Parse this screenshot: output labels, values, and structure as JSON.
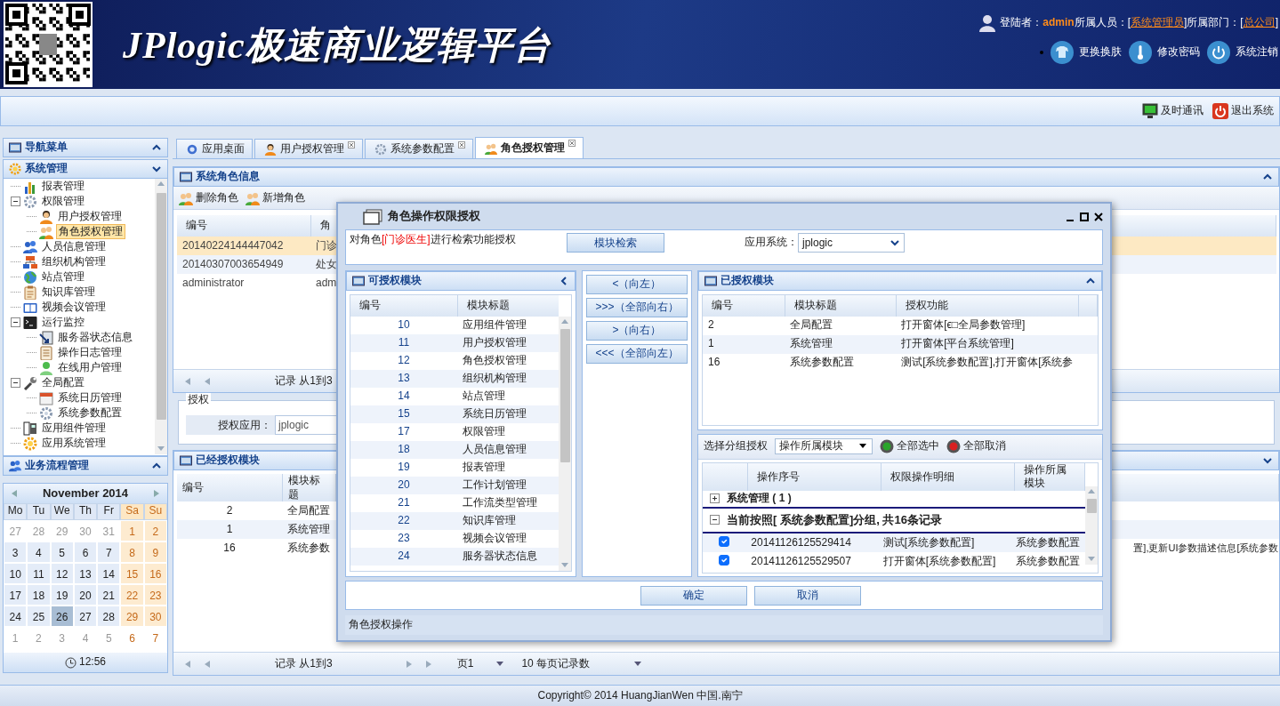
{
  "header": {
    "title": "JPlogic极速商业逻辑平台",
    "user_info": [
      {
        "text": "登陆者：",
        "kind": "label"
      },
      {
        "text": "admin",
        "kind": "value"
      },
      {
        "text": "所属人员：[",
        "kind": "label"
      },
      {
        "text": "系统管理员",
        "kind": "link"
      },
      {
        "text": "]所属部门：[",
        "kind": "label"
      },
      {
        "text": "总公司",
        "kind": "link"
      },
      {
        "text": "]",
        "kind": "label"
      }
    ],
    "actions": [
      {
        "label": "更换换肤"
      },
      {
        "label": "修改密码"
      },
      {
        "label": "系统注销"
      }
    ]
  },
  "toolbar": {
    "actions": [
      {
        "label": "及时通讯"
      },
      {
        "label": "退出系统"
      }
    ]
  },
  "sidebar": {
    "title": "导航菜单",
    "sections": [
      {
        "title": "系统管理",
        "expanded": true,
        "tree": [
          {
            "label": "报表管理",
            "selected": false
          },
          {
            "label": "权限管理",
            "selected": false,
            "expanded": true,
            "children": [
              {
                "label": "用户授权管理",
                "selected": false
              },
              {
                "label": "角色授权管理",
                "selected": true
              }
            ]
          },
          {
            "label": "人员信息管理",
            "selected": false
          },
          {
            "label": "组织机构管理",
            "selected": false
          },
          {
            "label": "站点管理",
            "selected": false
          },
          {
            "label": "知识库管理",
            "selected": false
          },
          {
            "label": "视频会议管理",
            "selected": false
          },
          {
            "label": "运行监控",
            "selected": false,
            "expanded": true,
            "children": [
              {
                "label": "服务器状态信息",
                "selected": false
              },
              {
                "label": "操作日志管理",
                "selected": false
              },
              {
                "label": "在线用户管理",
                "selected": false
              }
            ]
          },
          {
            "label": "全局配置",
            "selected": false,
            "expanded": true,
            "children": [
              {
                "label": "系统日历管理",
                "selected": false
              },
              {
                "label": "系统参数配置",
                "selected": false
              }
            ]
          },
          {
            "label": "应用组件管理",
            "selected": false
          },
          {
            "label": "应用系统管理",
            "selected": false
          }
        ]
      },
      {
        "title": "业务流程管理",
        "expanded": false
      }
    ]
  },
  "calendar": {
    "month": "November 2014",
    "weekdays": [
      "Mo",
      "Tu",
      "We",
      "Th",
      "Fr",
      "Sa",
      "Su"
    ],
    "weeks": [
      [
        {
          "day": "27",
          "other": true,
          "selected": false
        },
        {
          "day": "28",
          "other": true,
          "selected": false
        },
        {
          "day": "29",
          "other": true,
          "selected": false
        },
        {
          "day": "30",
          "other": true,
          "selected": false
        },
        {
          "day": "31",
          "other": true,
          "selected": false
        },
        {
          "day": "1",
          "other": false,
          "selected": false
        },
        {
          "day": "2",
          "other": false,
          "selected": false
        }
      ],
      [
        {
          "day": "3",
          "other": false,
          "selected": false
        },
        {
          "day": "4",
          "other": false,
          "selected": false
        },
        {
          "day": "5",
          "other": false,
          "selected": false
        },
        {
          "day": "6",
          "other": false,
          "selected": false
        },
        {
          "day": "7",
          "other": false,
          "selected": false
        },
        {
          "day": "8",
          "other": false,
          "selected": false
        },
        {
          "day": "9",
          "other": false,
          "selected": false
        }
      ],
      [
        {
          "day": "10",
          "other": false,
          "selected": false
        },
        {
          "day": "11",
          "other": false,
          "selected": false
        },
        {
          "day": "12",
          "other": false,
          "selected": false
        },
        {
          "day": "13",
          "other": false,
          "selected": false
        },
        {
          "day": "14",
          "other": false,
          "selected": false
        },
        {
          "day": "15",
          "other": false,
          "selected": false
        },
        {
          "day": "16",
          "other": false,
          "selected": false
        }
      ],
      [
        {
          "day": "17",
          "other": false,
          "selected": false
        },
        {
          "day": "18",
          "other": false,
          "selected": false
        },
        {
          "day": "19",
          "other": false,
          "selected": false
        },
        {
          "day": "20",
          "other": false,
          "selected": false
        },
        {
          "day": "21",
          "other": false,
          "selected": false
        },
        {
          "day": "22",
          "other": false,
          "selected": false
        },
        {
          "day": "23",
          "other": false,
          "selected": false
        }
      ],
      [
        {
          "day": "24",
          "other": false,
          "selected": false
        },
        {
          "day": "25",
          "other": false,
          "selected": false
        },
        {
          "day": "26",
          "other": false,
          "selected": true
        },
        {
          "day": "27",
          "other": false,
          "selected": false
        },
        {
          "day": "28",
          "other": false,
          "selected": false
        },
        {
          "day": "29",
          "other": false,
          "selected": false
        },
        {
          "day": "30",
          "other": false,
          "selected": false
        }
      ],
      [
        {
          "day": "1",
          "other": true,
          "selected": false
        },
        {
          "day": "2",
          "other": true,
          "selected": false
        },
        {
          "day": "3",
          "other": true,
          "selected": false
        },
        {
          "day": "4",
          "other": true,
          "selected": false
        },
        {
          "day": "5",
          "other": true,
          "selected": false
        },
        {
          "day": "6",
          "other": true,
          "selected": false
        },
        {
          "day": "7",
          "other": true,
          "selected": false
        }
      ]
    ],
    "time": "12:56"
  },
  "tabs": [
    {
      "label": "应用桌面",
      "closable": false,
      "selected": false
    },
    {
      "label": "用户授权管理",
      "closable": true,
      "selected": false
    },
    {
      "label": "系统参数配置",
      "closable": true,
      "selected": false
    },
    {
      "label": "角色授权管理",
      "closable": true,
      "selected": true
    }
  ],
  "roles_panel": {
    "title": "系统角色信息",
    "actions": [
      {
        "label": "删除角色"
      },
      {
        "label": "新增角色"
      }
    ],
    "columns": [
      "编号",
      "角"
    ],
    "rows": [
      {
        "cells": [
          "20140224144447042",
          "门诊"
        ],
        "selected": true
      },
      {
        "cells": [
          "20140307003654949",
          "处女"
        ],
        "selected": false
      },
      {
        "cells": [
          "administrator",
          "adm"
        ],
        "selected": false
      }
    ],
    "pager": {
      "records": "记录 从1到3"
    }
  },
  "grant": {
    "legend": "授权",
    "label": "授权应用：",
    "value": "jplogic"
  },
  "granted_panel": {
    "title": "已经授权模块",
    "columns": [
      "编号",
      "模块标题"
    ],
    "rows": [
      {
        "cells": [
          "2",
          "全局配置"
        ]
      },
      {
        "cells": [
          "1",
          "系统管理"
        ]
      },
      {
        "cells": [
          "16",
          "系统参数"
        ],
        "tail": "置],更新UI参数描述信息[系统参数"
      }
    ],
    "pager": {
      "records": "记录 从1到3",
      "page": "页1",
      "page_size": "10 每页记录数"
    }
  },
  "dialog": {
    "title": "角色操作权限授权",
    "prompt": [
      {
        "text": "对角色",
        "kind": "label"
      },
      {
        "text": "[门诊医生]",
        "kind": "role"
      },
      {
        "text": "进行检索功能授权",
        "kind": "label"
      }
    ],
    "search_button": "模块检索",
    "app_label": "应用系统：",
    "app_value": "jplogic",
    "available": {
      "title": "可授权模块",
      "columns": [
        "编号",
        "模块标题"
      ],
      "rows": [
        [
          "10",
          "应用组件管理"
        ],
        [
          "11",
          "用户授权管理"
        ],
        [
          "12",
          "角色授权管理"
        ],
        [
          "13",
          "组织机构管理"
        ],
        [
          "14",
          "站点管理"
        ],
        [
          "15",
          "系统日历管理"
        ],
        [
          "17",
          "权限管理"
        ],
        [
          "18",
          "人员信息管理"
        ],
        [
          "19",
          "报表管理"
        ],
        [
          "20",
          "工作计划管理"
        ],
        [
          "21",
          "工作流类型管理"
        ],
        [
          "22",
          "知识库管理"
        ],
        [
          "23",
          "视频会议管理"
        ],
        [
          "24",
          "服务器状态信息"
        ]
      ]
    },
    "move_buttons": [
      "<（向左）",
      ">>>（全部向右）",
      ">（向右）",
      "<<<（全部向左）"
    ],
    "granted": {
      "title": "已授权模块",
      "columns": [
        "编号",
        "模块标题",
        "授权功能"
      ],
      "rows": [
        [
          "2",
          "全局配置",
          "打开窗体[ϵ□全局参数管理]"
        ],
        [
          "1",
          "系统管理",
          "打开窗体[平台系统管理]"
        ],
        [
          "16",
          "系统参数配置",
          "测试[系统参数配置],打开窗体[系统参"
        ]
      ]
    },
    "operations": {
      "group_label": "选择分组授权",
      "group_value": "操作所属模块",
      "select_all": "全部选中",
      "deselect_all": "全部取消",
      "columns": [
        "操作序号",
        "权限操作明细",
        "操作所属模块"
      ],
      "groups": [
        {
          "title": "系统管理 ( 1 )",
          "expanded": false
        },
        {
          "title": "当前按照[ 系统参数配置]分组, 共16条记录",
          "expanded": true,
          "rows": [
            {
              "id": "20141126125529414",
              "detail": "测试[系统参数配置]",
              "module": "系统参数配置",
              "checked": true
            },
            {
              "id": "20141126125529507",
              "detail": "打开窗体[系统参数配置]",
              "module": "系统参数配置",
              "checked": true
            }
          ]
        }
      ]
    },
    "ok": "确定",
    "cancel": "取消",
    "status": "角色授权操作"
  },
  "footer": "Copyright© 2014 HuangJianWen 中国.南宁"
}
